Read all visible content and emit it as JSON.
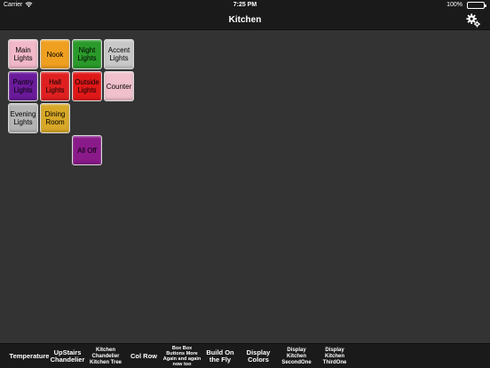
{
  "status_bar": {
    "carrier": "Carrier",
    "time": "7:25 PM",
    "battery": "100%"
  },
  "nav": {
    "title": "Kitchen"
  },
  "buttons": [
    {
      "id": "main-lights",
      "label": "Main Lights",
      "color": "#f0b8c8"
    },
    {
      "id": "nook",
      "label": "Nook",
      "color": "#f0a020"
    },
    {
      "id": "night-lights",
      "label": "Night Lights",
      "color": "#2a9a2a"
    },
    {
      "id": "accent-lights",
      "label": "Accent Lights",
      "color": "#c8c8c8"
    },
    {
      "id": "pantry-lights",
      "label": "Pantry Lights",
      "color": "#6a1a9a"
    },
    {
      "id": "hall-lights",
      "label": "Hall Lights",
      "color": "#e02020"
    },
    {
      "id": "outside-lights",
      "label": "Outside Lights",
      "color": "#e01818"
    },
    {
      "id": "counter",
      "label": "Counter",
      "color": "#f0c0cc"
    },
    {
      "id": "evening-lights",
      "label": "Evening Lights",
      "color": "#b4b4b4"
    },
    {
      "id": "dining-room",
      "label": "Dining Room",
      "color": "#d8a828"
    },
    {
      "id": "all-off",
      "label": "All Off",
      "color": "#8a1a8a"
    }
  ],
  "tabs": [
    {
      "id": "temperature",
      "label": "Temperature"
    },
    {
      "id": "upstairs-chandelier",
      "label": "UpStairs Chandelier"
    },
    {
      "id": "kitchen-chandelier-kitchen-tree",
      "label": "Kitchen Chandelier Kitchen Tree"
    },
    {
      "id": "col-row",
      "label": "Col Row"
    },
    {
      "id": "box-box",
      "label": "Box Box Buttons More Again and again now too"
    },
    {
      "id": "build-on-the-fly",
      "label": "Build On the Fly"
    },
    {
      "id": "display-colors",
      "label": "Display Colors"
    },
    {
      "id": "display-kitchen-secondone",
      "label": "Display Kitchen SecondOne"
    },
    {
      "id": "display-kitchen-thirdone",
      "label": "Display Kitchen ThirdOne"
    }
  ]
}
